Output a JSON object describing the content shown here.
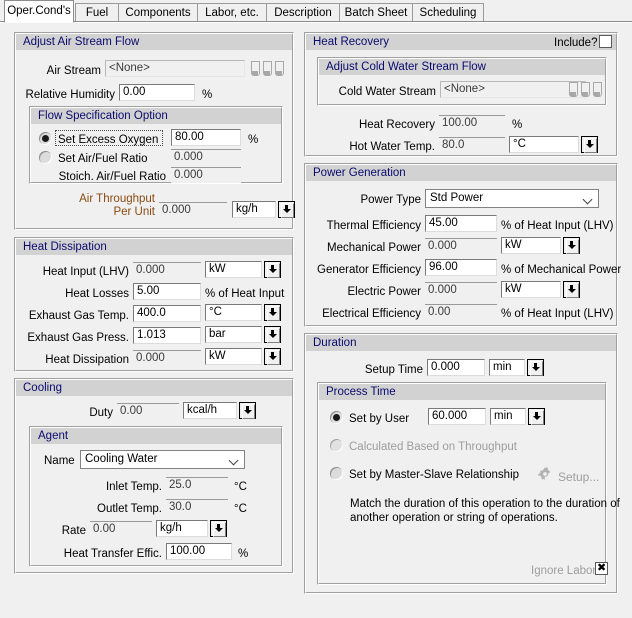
{
  "tabs": [
    {
      "label": "Oper.Cond's",
      "active": true
    },
    {
      "label": "Fuel",
      "active": false
    },
    {
      "label": "Components",
      "active": false
    },
    {
      "label": "Labor, etc.",
      "active": false
    },
    {
      "label": "Description",
      "active": false
    },
    {
      "label": "Batch Sheet",
      "active": false
    },
    {
      "label": "Scheduling",
      "active": false
    }
  ],
  "air_stream_flow": {
    "title": "Adjust Air Stream Flow",
    "air_stream_label": "Air Stream",
    "air_stream_value": "<None>",
    "relative_humidity_label": "Relative Humidity",
    "relative_humidity_value": "0.00",
    "relative_humidity_unit": "%",
    "flow_spec": {
      "title": "Flow Specification Option",
      "excess_oxygen_label": "Set Excess Oxygen",
      "excess_oxygen_value": "80.00",
      "excess_oxygen_unit": "%",
      "air_fuel_ratio_label": "Set Air/Fuel Ratio",
      "air_fuel_ratio_value": "0.000",
      "stoich_label": "Stoich. Air/Fuel Ratio",
      "stoich_value": "0.000"
    },
    "air_throughput_label_1": "Air Throughput",
    "air_throughput_label_2": "Per Unit",
    "air_throughput_value": "0.000",
    "air_throughput_unit": "kg/h"
  },
  "heat_dissipation": {
    "title": "Heat Dissipation",
    "rows": [
      {
        "label": "Heat Input (LHV)",
        "value": "0.000",
        "unit": "kW",
        "unit_dropdown": true,
        "readonly": true
      },
      {
        "label": "Heat Losses",
        "value": "5.00",
        "unit": "% of Heat Input",
        "unit_dropdown": false,
        "readonly": false
      },
      {
        "label": "Exhaust Gas Temp.",
        "value": "400.0",
        "unit": "°C",
        "unit_dropdown": true,
        "readonly": false
      },
      {
        "label": "Exhaust Gas Press.",
        "value": "1.013",
        "unit": "bar",
        "unit_dropdown": true,
        "readonly": false
      },
      {
        "label": "Heat Dissipation",
        "value": "0.000",
        "unit": "kW",
        "unit_dropdown": true,
        "readonly": true
      }
    ]
  },
  "cooling": {
    "title": "Cooling",
    "duty_label": "Duty",
    "duty_value": "0.00",
    "duty_unit": "kcal/h",
    "agent": {
      "title": "Agent",
      "name_label": "Name",
      "name_value": "Cooling Water",
      "inlet_label": "Inlet Temp.",
      "inlet_value": "25.0",
      "inlet_unit": "°C",
      "outlet_label": "Outlet Temp.",
      "outlet_value": "30.0",
      "outlet_unit": "°C",
      "rate_label": "Rate",
      "rate_value": "0.00",
      "rate_unit": "kg/h",
      "hte_label": "Heat Transfer Effic.",
      "hte_value": "100.00",
      "hte_unit": "%"
    }
  },
  "heat_recovery": {
    "title": "Heat Recovery",
    "include_label": "Include?",
    "include_checked": false,
    "cold_water": {
      "title": "Adjust Cold Water Stream Flow",
      "stream_label": "Cold Water Stream",
      "stream_value": "<None>"
    },
    "recovery_label": "Heat Recovery",
    "recovery_value": "100.00",
    "recovery_unit": "%",
    "hot_water_label": "Hot Water Temp.",
    "hot_water_value": "80.0",
    "hot_water_unit": "°C"
  },
  "power_generation": {
    "title": "Power Generation",
    "power_type_label": "Power Type",
    "power_type_value": "Std Power",
    "rows": [
      {
        "label": "Thermal Efficiency",
        "value": "45.00",
        "unit": "% of Heat Input (LHV)",
        "unit_dropdown": false,
        "readonly": false
      },
      {
        "label": "Mechanical Power",
        "value": "0.000",
        "unit": "kW",
        "unit_dropdown": true,
        "readonly": true
      },
      {
        "label": "Generator Efficiency",
        "value": "96.00",
        "unit": "% of Mechanical Power",
        "unit_dropdown": false,
        "readonly": false
      },
      {
        "label": "Electric Power",
        "value": "0.000",
        "unit": "kW",
        "unit_dropdown": true,
        "readonly": true
      },
      {
        "label": "Electrical Efficiency",
        "value": "0.00",
        "unit": "% of Heat Input (LHV)",
        "unit_dropdown": false,
        "readonly": true
      }
    ]
  },
  "duration": {
    "title": "Duration",
    "setup_time_label": "Setup Time",
    "setup_time_value": "0.000",
    "setup_time_unit": "min",
    "process_time": {
      "title": "Process Time",
      "set_by_user_label": "Set by User",
      "set_by_user_value": "60.000",
      "set_by_user_unit": "min",
      "calculated_label": "Calculated Based on Throughput",
      "master_slave_label": "Set by Master-Slave Relationship",
      "setup_button_label": "Setup...",
      "description_line1": "Match the duration of this operation to the duration of",
      "description_line2": "another operation or string of operations.",
      "ignore_labor_label": "Ignore Labor",
      "ignore_labor_checked": true
    }
  },
  "colors": {
    "header_bg": "#d2d2d2",
    "header_text": "#0a0a6e",
    "window_bg": "#f0f0f0",
    "orange_label": "#8a4b14"
  }
}
